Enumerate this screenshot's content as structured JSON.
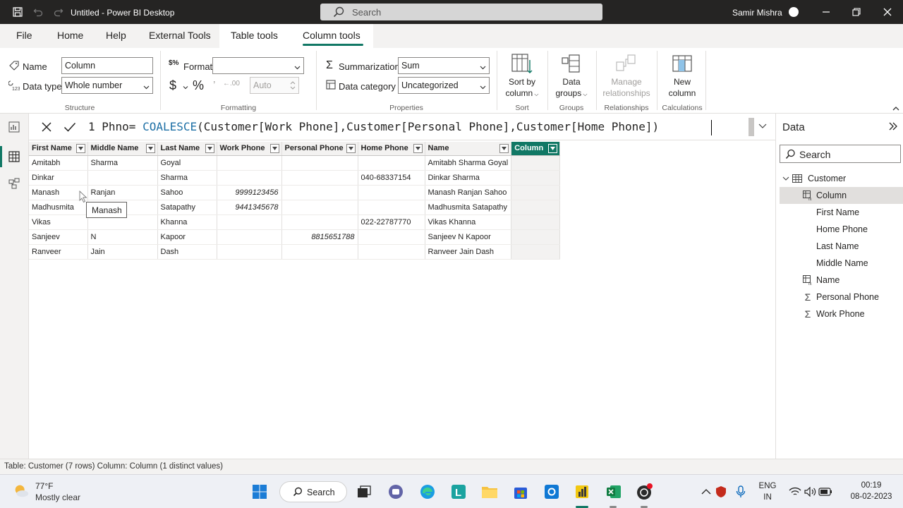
{
  "titlebar": {
    "title": "Untitled - Power BI Desktop",
    "search": "Search",
    "user": "Samir Mishra"
  },
  "menu": {
    "tabs": [
      "File",
      "Home",
      "Help",
      "External Tools",
      "Table tools",
      "Column tools"
    ],
    "active": "Column tools"
  },
  "ribbon": {
    "structure": {
      "name_label": "Name",
      "name_value": "Column",
      "datatype_label": "Data type",
      "datatype_value": "Whole number",
      "group": "Structure"
    },
    "formatting": {
      "format_label": "Format",
      "format_value": "",
      "currency": "$",
      "percent": "%",
      "auto": "Auto",
      "group": "Formatting"
    },
    "properties": {
      "summarization_label": "Summarization",
      "summarization_value": "Sum",
      "category_label": "Data category",
      "category_value": "Uncategorized",
      "group": "Properties"
    },
    "sort": {
      "label1": "Sort by",
      "label2": "column",
      "group": "Sort"
    },
    "groups": {
      "label1": "Data",
      "label2": "groups",
      "group": "Groups"
    },
    "relationships": {
      "label1": "Manage",
      "label2": "relationships",
      "group": "Relationships"
    },
    "calculations": {
      "label1": "New",
      "label2": "column",
      "group": "Calculations"
    }
  },
  "formula": {
    "line_no": "1",
    "prefix": " Phno= ",
    "fn": "COALESCE",
    "open": "(",
    "args": "Customer[Work Phone],Customer[Personal Phone],Customer[Home Phone]",
    "close": ")"
  },
  "table": {
    "columns": [
      "First Name",
      "Middle Name",
      "Last Name",
      "Work Phone",
      "Personal Phone",
      "Home Phone",
      "Name",
      "Column"
    ],
    "rows": [
      [
        "Amitabh",
        "Sharma",
        "Goyal",
        "",
        "",
        "",
        "Amitabh Sharma Goyal",
        ""
      ],
      [
        "Dinkar",
        "",
        "Sharma",
        "",
        "",
        "040-68337154",
        "Dinkar  Sharma",
        ""
      ],
      [
        "Manash",
        "Ranjan",
        "Sahoo",
        "9999123456",
        "",
        "",
        "Manash Ranjan Sahoo",
        ""
      ],
      [
        "Madhusmita",
        "",
        "Satapathy",
        "9441345678",
        "",
        "",
        "Madhusmita  Satapathy",
        ""
      ],
      [
        "Vikas",
        "",
        "Khanna",
        "",
        "",
        "022-22787770",
        "Vikas  Khanna",
        ""
      ],
      [
        "Sanjeev",
        "N",
        "Kapoor",
        "",
        "8815651788",
        "",
        "Sanjeev N Kapoor",
        ""
      ],
      [
        "Ranveer",
        "Jain",
        "Dash",
        "",
        "",
        "",
        "Ranveer Jain Dash",
        ""
      ]
    ],
    "tooltip": "Manash"
  },
  "datapane": {
    "title": "Data",
    "search": "Search",
    "table_name": "Customer",
    "fields": [
      "Column",
      "First Name",
      "Home Phone",
      "Last Name",
      "Middle Name",
      "Name",
      "Personal Phone",
      "Work Phone"
    ]
  },
  "status": "Table: Customer (7 rows) Column: Column (1 distinct values)",
  "taskbar": {
    "temp": "77°F",
    "weather": "Mostly clear",
    "search": "Search",
    "lang1": "ENG",
    "lang2": "IN",
    "time": "00:19",
    "date": "08-02-2023"
  },
  "colors": {
    "accent": "#117865",
    "titlebar": "#252423",
    "formula_fn": "#1d6fa5"
  }
}
